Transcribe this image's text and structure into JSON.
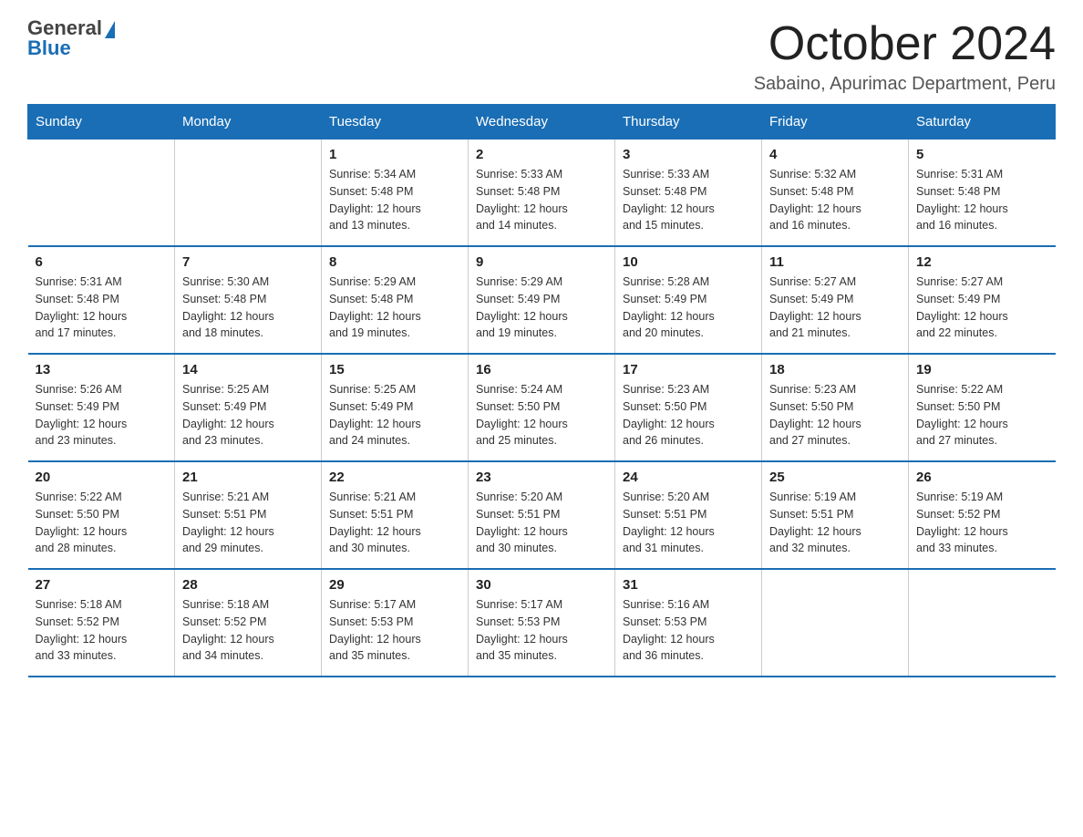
{
  "header": {
    "logo_line1": "General",
    "logo_line2": "Blue",
    "month_title": "October 2024",
    "location": "Sabaino, Apurimac Department, Peru"
  },
  "calendar": {
    "days_of_week": [
      "Sunday",
      "Monday",
      "Tuesday",
      "Wednesday",
      "Thursday",
      "Friday",
      "Saturday"
    ],
    "weeks": [
      [
        {
          "day": "",
          "info": ""
        },
        {
          "day": "",
          "info": ""
        },
        {
          "day": "1",
          "info": "Sunrise: 5:34 AM\nSunset: 5:48 PM\nDaylight: 12 hours\nand 13 minutes."
        },
        {
          "day": "2",
          "info": "Sunrise: 5:33 AM\nSunset: 5:48 PM\nDaylight: 12 hours\nand 14 minutes."
        },
        {
          "day": "3",
          "info": "Sunrise: 5:33 AM\nSunset: 5:48 PM\nDaylight: 12 hours\nand 15 minutes."
        },
        {
          "day": "4",
          "info": "Sunrise: 5:32 AM\nSunset: 5:48 PM\nDaylight: 12 hours\nand 16 minutes."
        },
        {
          "day": "5",
          "info": "Sunrise: 5:31 AM\nSunset: 5:48 PM\nDaylight: 12 hours\nand 16 minutes."
        }
      ],
      [
        {
          "day": "6",
          "info": "Sunrise: 5:31 AM\nSunset: 5:48 PM\nDaylight: 12 hours\nand 17 minutes."
        },
        {
          "day": "7",
          "info": "Sunrise: 5:30 AM\nSunset: 5:48 PM\nDaylight: 12 hours\nand 18 minutes."
        },
        {
          "day": "8",
          "info": "Sunrise: 5:29 AM\nSunset: 5:48 PM\nDaylight: 12 hours\nand 19 minutes."
        },
        {
          "day": "9",
          "info": "Sunrise: 5:29 AM\nSunset: 5:49 PM\nDaylight: 12 hours\nand 19 minutes."
        },
        {
          "day": "10",
          "info": "Sunrise: 5:28 AM\nSunset: 5:49 PM\nDaylight: 12 hours\nand 20 minutes."
        },
        {
          "day": "11",
          "info": "Sunrise: 5:27 AM\nSunset: 5:49 PM\nDaylight: 12 hours\nand 21 minutes."
        },
        {
          "day": "12",
          "info": "Sunrise: 5:27 AM\nSunset: 5:49 PM\nDaylight: 12 hours\nand 22 minutes."
        }
      ],
      [
        {
          "day": "13",
          "info": "Sunrise: 5:26 AM\nSunset: 5:49 PM\nDaylight: 12 hours\nand 23 minutes."
        },
        {
          "day": "14",
          "info": "Sunrise: 5:25 AM\nSunset: 5:49 PM\nDaylight: 12 hours\nand 23 minutes."
        },
        {
          "day": "15",
          "info": "Sunrise: 5:25 AM\nSunset: 5:49 PM\nDaylight: 12 hours\nand 24 minutes."
        },
        {
          "day": "16",
          "info": "Sunrise: 5:24 AM\nSunset: 5:50 PM\nDaylight: 12 hours\nand 25 minutes."
        },
        {
          "day": "17",
          "info": "Sunrise: 5:23 AM\nSunset: 5:50 PM\nDaylight: 12 hours\nand 26 minutes."
        },
        {
          "day": "18",
          "info": "Sunrise: 5:23 AM\nSunset: 5:50 PM\nDaylight: 12 hours\nand 27 minutes."
        },
        {
          "day": "19",
          "info": "Sunrise: 5:22 AM\nSunset: 5:50 PM\nDaylight: 12 hours\nand 27 minutes."
        }
      ],
      [
        {
          "day": "20",
          "info": "Sunrise: 5:22 AM\nSunset: 5:50 PM\nDaylight: 12 hours\nand 28 minutes."
        },
        {
          "day": "21",
          "info": "Sunrise: 5:21 AM\nSunset: 5:51 PM\nDaylight: 12 hours\nand 29 minutes."
        },
        {
          "day": "22",
          "info": "Sunrise: 5:21 AM\nSunset: 5:51 PM\nDaylight: 12 hours\nand 30 minutes."
        },
        {
          "day": "23",
          "info": "Sunrise: 5:20 AM\nSunset: 5:51 PM\nDaylight: 12 hours\nand 30 minutes."
        },
        {
          "day": "24",
          "info": "Sunrise: 5:20 AM\nSunset: 5:51 PM\nDaylight: 12 hours\nand 31 minutes."
        },
        {
          "day": "25",
          "info": "Sunrise: 5:19 AM\nSunset: 5:51 PM\nDaylight: 12 hours\nand 32 minutes."
        },
        {
          "day": "26",
          "info": "Sunrise: 5:19 AM\nSunset: 5:52 PM\nDaylight: 12 hours\nand 33 minutes."
        }
      ],
      [
        {
          "day": "27",
          "info": "Sunrise: 5:18 AM\nSunset: 5:52 PM\nDaylight: 12 hours\nand 33 minutes."
        },
        {
          "day": "28",
          "info": "Sunrise: 5:18 AM\nSunset: 5:52 PM\nDaylight: 12 hours\nand 34 minutes."
        },
        {
          "day": "29",
          "info": "Sunrise: 5:17 AM\nSunset: 5:53 PM\nDaylight: 12 hours\nand 35 minutes."
        },
        {
          "day": "30",
          "info": "Sunrise: 5:17 AM\nSunset: 5:53 PM\nDaylight: 12 hours\nand 35 minutes."
        },
        {
          "day": "31",
          "info": "Sunrise: 5:16 AM\nSunset: 5:53 PM\nDaylight: 12 hours\nand 36 minutes."
        },
        {
          "day": "",
          "info": ""
        },
        {
          "day": "",
          "info": ""
        }
      ]
    ]
  }
}
